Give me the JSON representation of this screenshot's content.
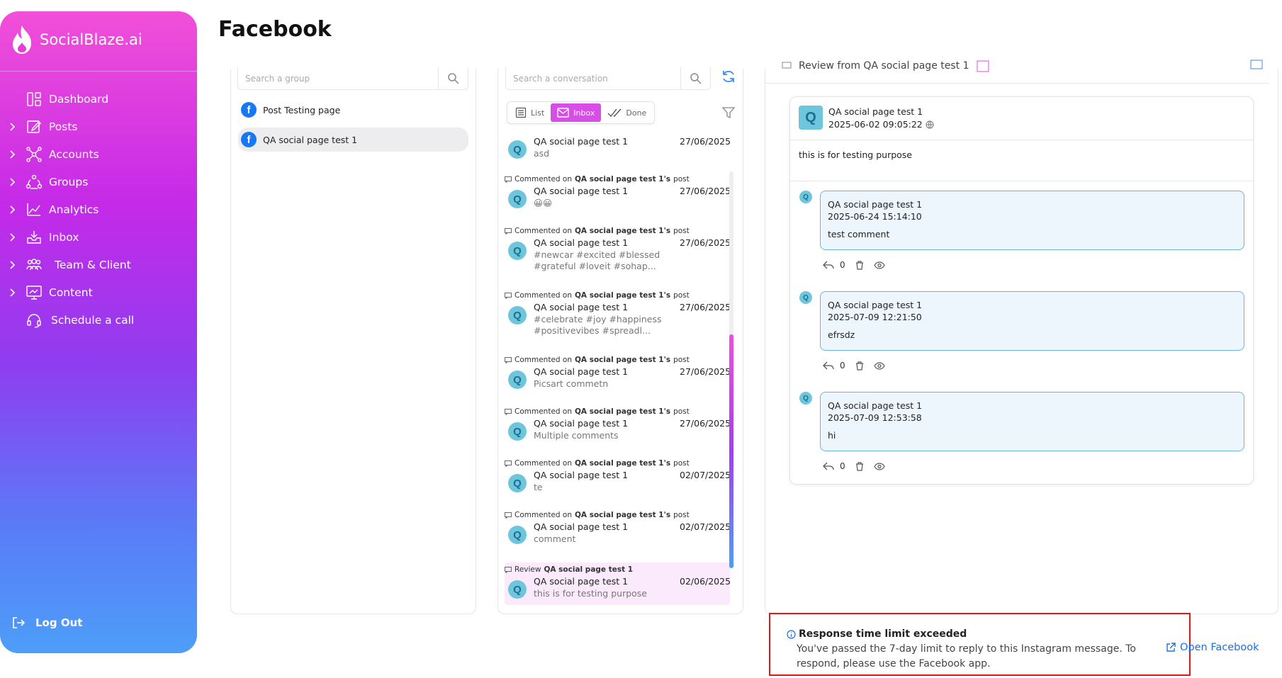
{
  "sidebar": {
    "brand": "SocialBlaze.ai",
    "items": [
      {
        "label": "Dashboard",
        "icon": "dashboard-icon",
        "chevron": false
      },
      {
        "label": "Posts",
        "icon": "posts-icon",
        "chevron": true
      },
      {
        "label": "Accounts",
        "icon": "accounts-icon",
        "chevron": true
      },
      {
        "label": "Groups",
        "icon": "groups-icon",
        "chevron": true
      },
      {
        "label": "Analytics",
        "icon": "analytics-icon",
        "chevron": true
      },
      {
        "label": "Inbox",
        "icon": "inbox-icon",
        "chevron": true
      },
      {
        "label": "Team & Client",
        "icon": "team-icon",
        "chevron": true
      },
      {
        "label": "Content",
        "icon": "content-icon",
        "chevron": true
      },
      {
        "label": "Schedule a call",
        "icon": "headset-icon",
        "chevron": false
      }
    ],
    "logout": "Log Out"
  },
  "page_title": "Facebook",
  "groups": {
    "search_placeholder": "Search a group",
    "items": [
      {
        "label": "Post Testing page",
        "selected": false
      },
      {
        "label": "QA social page test 1",
        "selected": true
      }
    ]
  },
  "conversations": {
    "search_placeholder": "Search a conversation",
    "tabs": [
      {
        "label": "List",
        "active": false
      },
      {
        "label": "Inbox",
        "active": true
      },
      {
        "label": "Done",
        "active": false
      }
    ],
    "items": [
      {
        "ctx_prefix": "",
        "ctx_bold": "",
        "ctx_suffix": "",
        "name": "QA social page test 1",
        "date": "27/06/2025",
        "preview": "asd",
        "avatar": "Q",
        "selected": false
      },
      {
        "ctx_prefix": "Commented on",
        "ctx_bold": "QA social page test 1's",
        "ctx_suffix": "post",
        "name": "QA social page test 1",
        "date": "27/06/2025",
        "preview": "😀😀",
        "avatar": "Q",
        "selected": false
      },
      {
        "ctx_prefix": "Commented on",
        "ctx_bold": "QA social page test 1's",
        "ctx_suffix": "post",
        "name": "QA social page test 1",
        "date": "27/06/2025",
        "preview": "#newcar #excited #blessed #grateful #loveit #sohap...",
        "avatar": "Q",
        "selected": false
      },
      {
        "ctx_prefix": "Commented on",
        "ctx_bold": "QA social page test 1's",
        "ctx_suffix": "post",
        "name": "QA social page test 1",
        "date": "27/06/2025",
        "preview": "#celebrate #joy #happiness #positivevibes #spreadl...",
        "avatar": "Q",
        "selected": false
      },
      {
        "ctx_prefix": "Commented on",
        "ctx_bold": "QA social page test 1's",
        "ctx_suffix": "post",
        "name": "QA social page test 1",
        "date": "27/06/2025",
        "preview": "Picsart commetn",
        "avatar": "Q",
        "selected": false
      },
      {
        "ctx_prefix": "Commented on",
        "ctx_bold": "QA social page test 1's",
        "ctx_suffix": "post",
        "name": "QA social page test 1",
        "date": "27/06/2025",
        "preview": "Multiple comments",
        "avatar": "Q",
        "selected": false
      },
      {
        "ctx_prefix": "Commented on",
        "ctx_bold": "QA social page test 1's",
        "ctx_suffix": "post",
        "name": "QA social page test 1",
        "date": "02/07/2025",
        "preview": "te",
        "avatar": "Q",
        "selected": false
      },
      {
        "ctx_prefix": "Commented on",
        "ctx_bold": "QA social page test 1's",
        "ctx_suffix": "post",
        "name": "QA social page test 1",
        "date": "02/07/2025",
        "preview": "comment",
        "avatar": "Q",
        "selected": false
      },
      {
        "ctx_prefix": "Review",
        "ctx_bold": "QA social page test 1",
        "ctx_suffix": "",
        "name": "QA social page test 1",
        "date": "02/06/2025",
        "preview": "this is for testing purpose",
        "avatar": "Q",
        "selected": true
      }
    ]
  },
  "detail": {
    "header_title": "Review from QA social page test 1",
    "post": {
      "avatar": "Q",
      "author": "QA social page test 1",
      "timestamp": "2025-06-02 09:05:22",
      "text": "this is for testing purpose"
    },
    "comments": [
      {
        "avatar": "Q",
        "author": "QA social page test 1",
        "timestamp": "2025-06-24 15:14:10",
        "text": "test comment",
        "reply_count": "0"
      },
      {
        "avatar": "Q",
        "author": "QA social page test 1",
        "timestamp": "2025-07-09 12:21:50",
        "text": "efrsdz",
        "reply_count": "0"
      },
      {
        "avatar": "Q",
        "author": "QA social page test 1",
        "timestamp": "2025-07-09 12:53:58",
        "text": "hi",
        "reply_count": "0"
      }
    ]
  },
  "alert": {
    "title": "Response time limit exceeded",
    "message": "You've passed the 7-day limit to reply to this Instagram message. To respond, please use the Facebook app.",
    "link": "Open Facebook"
  },
  "colors": {
    "accent": "#d84de8",
    "brand_gradient_top": "#f24fd8",
    "brand_gradient_bottom": "#4d9ef8",
    "facebook_blue": "#1877f2",
    "avatar_bg": "#6ec6dc",
    "link_blue": "#1d6fe0",
    "alert_border": "#e01818"
  }
}
